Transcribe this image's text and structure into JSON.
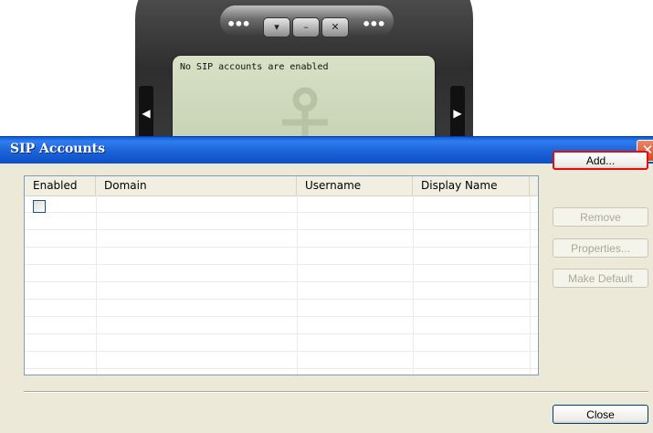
{
  "phone": {
    "status_text": "No SIP accounts are enabled",
    "top_buttons": [
      "▾",
      "–",
      "✕"
    ],
    "dots": "•••"
  },
  "dialog": {
    "title": "SIP Accounts",
    "close_glyph": "✕",
    "columns": [
      "Enabled",
      "Domain",
      "Username",
      "Display Name"
    ],
    "rows": [
      {
        "enabled": false,
        "domain": "",
        "username": "",
        "display_name": ""
      }
    ],
    "buttons": {
      "add": "Add...",
      "remove": "Remove",
      "properties": "Properties...",
      "make_default": "Make Default",
      "close": "Close"
    }
  },
  "colors": {
    "title_bar": "#1d63d8",
    "dialog_bg": "#ece9d8",
    "focus_ring": "#e01010"
  }
}
